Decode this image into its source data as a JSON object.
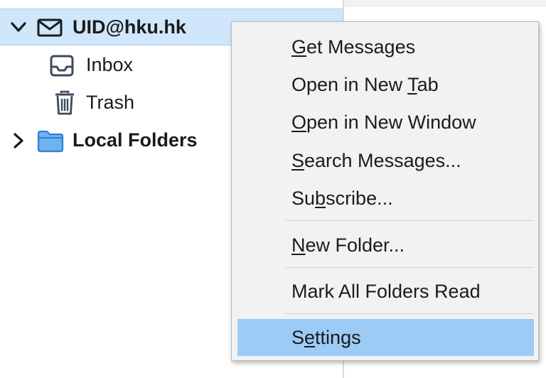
{
  "folder_tree": {
    "account": {
      "label": "UID@hku.hk",
      "expanded": true,
      "icon": "envelope-icon"
    },
    "inbox": {
      "label": "Inbox",
      "icon": "inbox-icon"
    },
    "trash": {
      "label": "Trash",
      "icon": "trash-icon"
    },
    "local_folders": {
      "label": "Local Folders",
      "expanded": false,
      "icon": "folder-icon"
    }
  },
  "context_menu": {
    "items": [
      {
        "label": "Get Messages",
        "mnemonic": "G"
      },
      {
        "label": "Open in New Tab",
        "mnemonic": "T"
      },
      {
        "label": "Open in New Window",
        "mnemonic": "O"
      },
      {
        "label": "Search Messages...",
        "mnemonic": "S"
      },
      {
        "label": "Subscribe...",
        "mnemonic": "b"
      },
      {
        "label": "New Folder...",
        "mnemonic": "N"
      },
      {
        "label": "Mark All Folders Read",
        "mnemonic": ""
      },
      {
        "label": "Settings",
        "mnemonic": "e"
      }
    ],
    "highlighted_item": "Settings"
  },
  "colors": {
    "selection": "#cfe6fb",
    "menu_highlight": "#9ccbf5",
    "folder_blue": "#3a8ee6"
  }
}
